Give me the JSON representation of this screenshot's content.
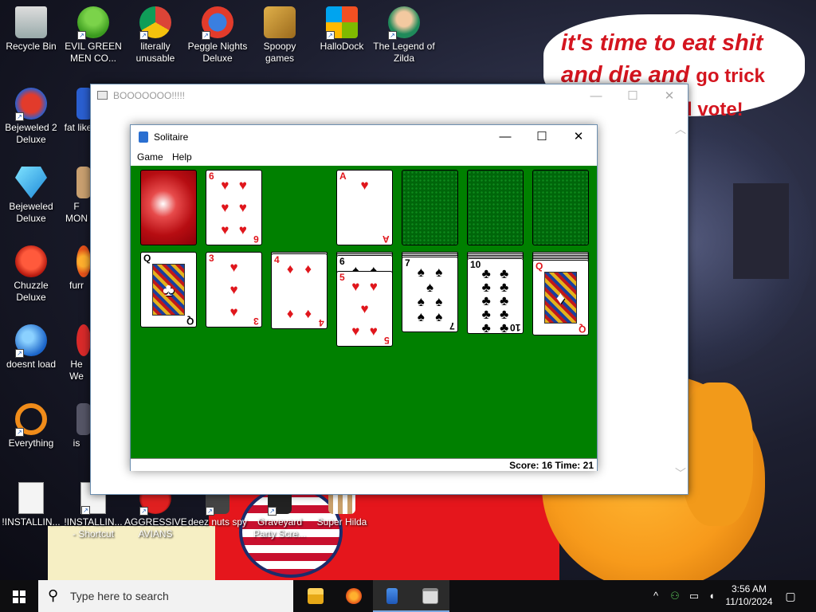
{
  "desktop": {
    "speech_bubble": {
      "line1": "it's time to eat shit",
      "line2_big": "and die and",
      "line2_small": "go trick",
      "line3": "d vote!"
    },
    "icons": [
      {
        "label": "Recycle Bin",
        "icon": "recycle-bin-icon"
      },
      {
        "label": "EVIL GREEN MEN CO...",
        "icon": "green-men-icon"
      },
      {
        "label": "literally unusable",
        "icon": "chrome-icon"
      },
      {
        "label": "Peggle Nights Deluxe",
        "icon": "peggle-icon"
      },
      {
        "label": "Spoopy games",
        "icon": "folder-icon"
      },
      {
        "label": "HalloDock",
        "icon": "windows-logo-icon"
      },
      {
        "label": "The Legend of Zilda",
        "icon": "zilda-icon"
      },
      {
        "label": "Bejeweled 2 Deluxe",
        "icon": "bejeweled2-icon"
      },
      {
        "label": "fat like",
        "icon": "app-icon"
      },
      {
        "label": "Bejeweled Deluxe",
        "icon": "gem-icon"
      },
      {
        "label": "F MON",
        "icon": "app-icon"
      },
      {
        "label": "Chuzzle Deluxe",
        "icon": "chuzzle-icon"
      },
      {
        "label": "furr",
        "icon": "firefox-icon"
      },
      {
        "label": "doesnt load",
        "icon": "thunderbird-icon"
      },
      {
        "label": "He We",
        "icon": "app-icon"
      },
      {
        "label": "Everything",
        "icon": "magnifier-icon"
      },
      {
        "label": "is",
        "icon": "app-icon"
      },
      {
        "label": "!INSTALLIN...",
        "icon": "document-icon"
      },
      {
        "label": "!INSTALLIN... - Shortcut",
        "icon": "document-icon"
      },
      {
        "label": "AGGRESSIVE AVIANS",
        "icon": "angry-bird-icon"
      },
      {
        "label": "deez nuts spy",
        "icon": "app-icon"
      },
      {
        "label": "Graveyard Party Scre...",
        "icon": "graveyard-icon"
      },
      {
        "label": "Super Hilda",
        "icon": "super-hilda-icon"
      }
    ]
  },
  "outer_window": {
    "title": "BOOOOOOO!!!!!",
    "minimize": "—",
    "maximize": "☐",
    "close": "✕"
  },
  "solitaire": {
    "title": "Solitaire",
    "minimize": "—",
    "maximize": "☐",
    "close": "✕",
    "menu": {
      "game": "Game",
      "help": "Help"
    },
    "status": "Score: 16 Time: 21",
    "score": 16,
    "time": 21,
    "waste_card": {
      "rank": "6",
      "suit": "♥",
      "color": "red"
    },
    "foundations": [
      {
        "rank": "A",
        "suit": "♥",
        "color": "red"
      },
      {
        "empty": true
      },
      {
        "empty": true
      },
      {
        "empty": true
      }
    ],
    "tableau": [
      {
        "top": {
          "rank": "Q",
          "suit": "♣",
          "color": "black",
          "face": true
        },
        "hidden_count": 0
      },
      {
        "top": {
          "rank": "3",
          "suit": "♥",
          "color": "red"
        },
        "hidden_count": 0
      },
      {
        "top": {
          "rank": "4",
          "suit": "♦",
          "color": "red"
        },
        "hidden_count": 1
      },
      {
        "top": {
          "rank": "5",
          "suit": "♥",
          "color": "red"
        },
        "under": {
          "rank": "6",
          "suit": "♠",
          "color": "black"
        },
        "hidden_count": 2
      },
      {
        "top": {
          "rank": "7",
          "suit": "♠",
          "color": "black"
        },
        "hidden_count": 3
      },
      {
        "top": {
          "rank": "10",
          "suit": "♣",
          "color": "black"
        },
        "hidden_count": 4
      },
      {
        "top": {
          "rank": "Q",
          "suit": "♦",
          "color": "red",
          "face": true
        },
        "hidden_count": 5
      }
    ]
  },
  "taskbar": {
    "search_placeholder": "Type here to search",
    "apps": [
      "file-explorer-icon",
      "firefox-icon",
      "solitaire-icon",
      "window-icon"
    ],
    "tray_chevron": "^",
    "time": "3:56 AM",
    "date": "11/10/2024"
  }
}
